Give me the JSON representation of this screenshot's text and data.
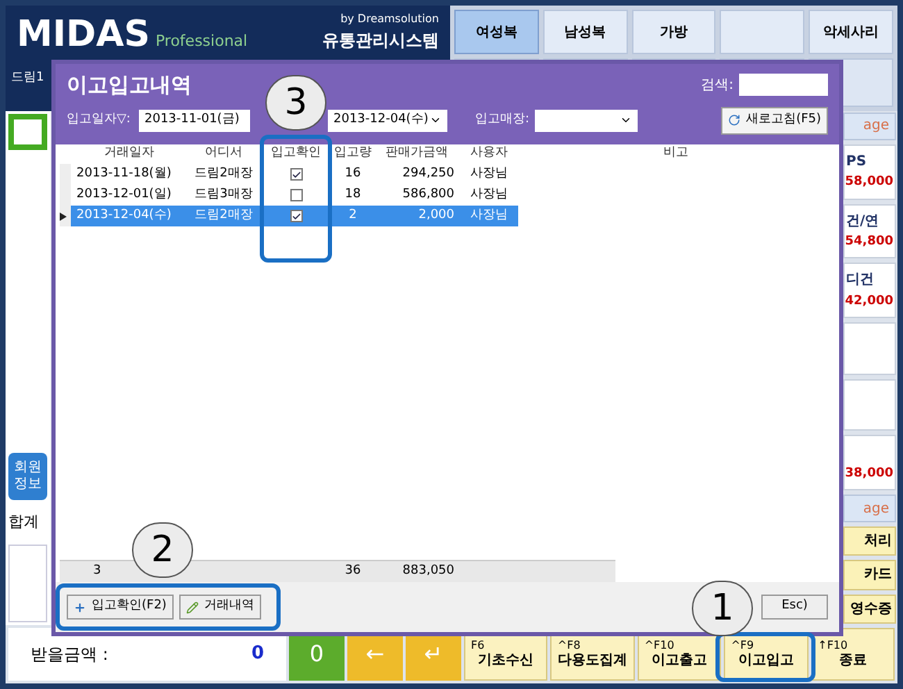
{
  "header": {
    "logo": "MIDAS",
    "edition": "Professional",
    "vendor": "by Dreamsolution",
    "system": "유통관리시스템"
  },
  "categories": [
    {
      "label": "여성복",
      "selected": true
    },
    {
      "label": "남성복",
      "selected": false
    },
    {
      "label": "가방",
      "selected": false
    },
    {
      "selected": false
    },
    {
      "label": "악세사리",
      "selected": false
    }
  ],
  "left_panel": {
    "shop": "드림1",
    "member_button": "회원\n정보",
    "total_label": "합계",
    "due_label": "받을금액 :",
    "due_value": "0"
  },
  "right_panel": [
    {
      "kind": "image",
      "name": "age"
    },
    {
      "kind": "product",
      "name": "PS",
      "price": "58,000"
    },
    {
      "kind": "product",
      "name": "건/연",
      "price": "54,800"
    },
    {
      "kind": "product",
      "name": "디건",
      "price": "42,000"
    },
    {
      "kind": "empty"
    },
    {
      "kind": "empty"
    },
    {
      "kind": "product",
      "price": "38,000"
    },
    {
      "kind": "image",
      "name": "age"
    },
    {
      "kind": "action",
      "name": "처리"
    },
    {
      "kind": "action",
      "name": "카드"
    },
    {
      "kind": "action",
      "name": "영수증"
    }
  ],
  "keypad": [
    {
      "label": "0",
      "kind": "number"
    },
    {
      "label": "←",
      "kind": "arrow"
    },
    {
      "label": "↵",
      "kind": "arrow"
    }
  ],
  "function_keys": [
    {
      "key": "F6",
      "label": "기초수신"
    },
    {
      "key": "^F8",
      "label": "다용도집계"
    },
    {
      "key": "^F10",
      "label": "이고출고"
    },
    {
      "key": "^F9",
      "label": "이고입고"
    },
    {
      "key": "↑F10",
      "label": "종료"
    }
  ],
  "dialog": {
    "title": "이고입고내역",
    "search_label": "검색:",
    "date_label": "입고일자▽:",
    "date_from": "2013-11-01(금)",
    "date_to": "2013-12-04(수)",
    "store_label": "입고매장:",
    "refresh_button": "새로고침(F5)",
    "table": {
      "columns": [
        "거래일자",
        "어디서",
        "입고확인",
        "입고량",
        "판매가금액",
        "사용자",
        "비고"
      ],
      "rows": [
        {
          "date": "2013-11-18(월)",
          "from": "드림2매장",
          "checked": true,
          "qty": "16",
          "amount": "294,250",
          "user": "사장님",
          "selected": false
        },
        {
          "date": "2013-12-01(일)",
          "from": "드림3매장",
          "checked": false,
          "qty": "18",
          "amount": "586,800",
          "user": "사장님",
          "selected": false
        },
        {
          "date": "2013-12-04(수)",
          "from": "드림2매장",
          "checked": true,
          "qty": "2",
          "amount": "2,000",
          "user": "사장님",
          "selected": true
        }
      ],
      "totals": {
        "count": "3",
        "qty": "36",
        "amount": "883,050"
      }
    },
    "buttons": [
      "입고확인(F2)",
      "거래내역"
    ],
    "close_button": "Esc)"
  },
  "callouts": [
    "3",
    "2",
    "1"
  ]
}
